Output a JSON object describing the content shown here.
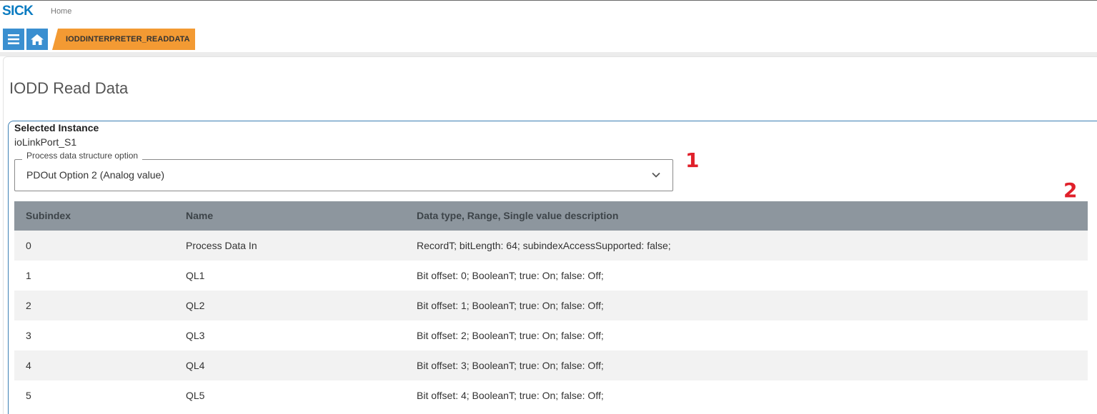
{
  "header": {
    "logo": "SICK",
    "home_link": "Home"
  },
  "nav": {
    "menu_icon": "hamburger-menu-icon",
    "home_icon": "home-icon",
    "active_tab": "IODDINTERPRETER_READDATA"
  },
  "page": {
    "title": "IODD Read Data"
  },
  "instance": {
    "label": "Selected Instance",
    "value": "ioLinkPort_S1"
  },
  "select": {
    "legend": "Process data structure option",
    "value": "PDOut Option 2 (Analog value)",
    "icon": "chevron-down-icon"
  },
  "annotations": {
    "one": "1",
    "two": "2",
    "color": "#e0202a"
  },
  "table": {
    "headers": [
      "Subindex",
      "Name",
      "Data type, Range, Single value description"
    ],
    "rows": [
      {
        "subindex": "0",
        "name": "Process Data In",
        "desc": "RecordT; bitLength: 64; subindexAccessSupported: false;"
      },
      {
        "subindex": "1",
        "name": "QL1",
        "desc": "Bit offset: 0; BooleanT; true: On; false: Off;"
      },
      {
        "subindex": "2",
        "name": "QL2",
        "desc": "Bit offset: 1; BooleanT; true: On; false: Off;"
      },
      {
        "subindex": "3",
        "name": "QL3",
        "desc": "Bit offset: 2; BooleanT; true: On; false: Off;"
      },
      {
        "subindex": "4",
        "name": "QL4",
        "desc": "Bit offset: 3; BooleanT; true: On; false: Off;"
      },
      {
        "subindex": "5",
        "name": "QL5",
        "desc": "Bit offset: 4; BooleanT; true: On; false: Off;"
      }
    ]
  },
  "colors": {
    "brand_blue": "#0a7bc1",
    "nav_button": "#3a8fd0",
    "tab_orange": "#f39a33",
    "table_header": "#8d969e"
  }
}
